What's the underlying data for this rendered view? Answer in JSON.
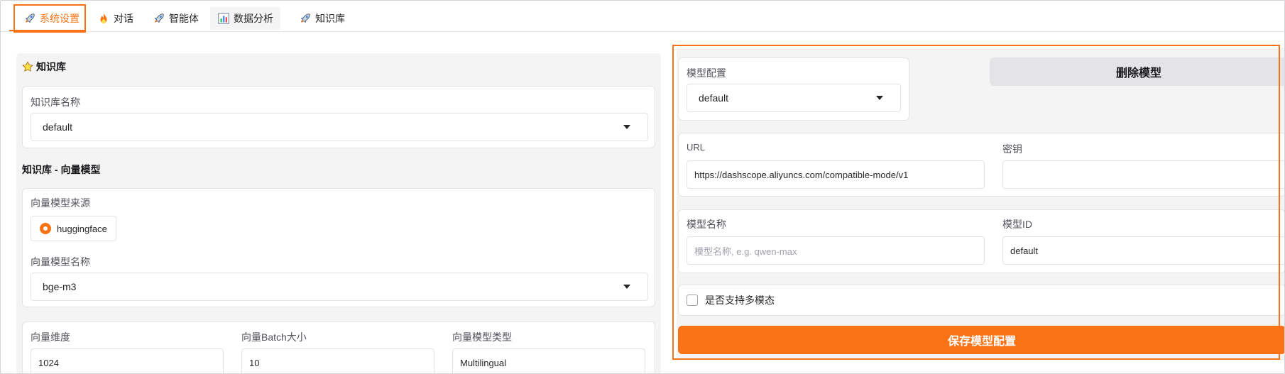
{
  "tabs": [
    {
      "label": "系统设置",
      "icon": "rocket-icon",
      "active": true
    },
    {
      "label": "对话",
      "icon": "flame-icon"
    },
    {
      "label": "智能体",
      "icon": "rocket-icon"
    },
    {
      "label": "数据分析",
      "icon": "bar-chart-icon"
    },
    {
      "label": "知识库",
      "icon": "rocket-icon"
    }
  ],
  "knowledge": {
    "title": "知识库",
    "name_label": "知识库名称",
    "name_value": "default",
    "vector_section_title": "知识库 - 向量模型",
    "source_label": "向量模型来源",
    "source_option": "huggingface",
    "model_name_label": "向量模型名称",
    "model_name_value": "bge-m3",
    "dim_label": "向量维度",
    "dim_value": "1024",
    "batch_label": "向量Batch大小",
    "batch_value": "10",
    "type_label": "向量模型类型",
    "type_value": "Multilingual"
  },
  "model_config": {
    "config_label": "模型配置",
    "config_value": "default",
    "delete_button": "删除模型",
    "url_label": "URL",
    "url_value": "https://dashscope.aliyuncs.com/compatible-mode/v1",
    "key_label": "密钥",
    "key_value": "",
    "name_label": "模型名称",
    "name_placeholder": "模型名称, e.g. qwen-max",
    "id_label": "模型ID",
    "id_value": "default",
    "multimodal_label": "是否支持多模态",
    "multimodal_checked": false,
    "save_button": "保存模型配置"
  },
  "colors": {
    "accent": "#f97316",
    "panel_bg": "#f4f4f5",
    "border": "#e4e4e7"
  }
}
